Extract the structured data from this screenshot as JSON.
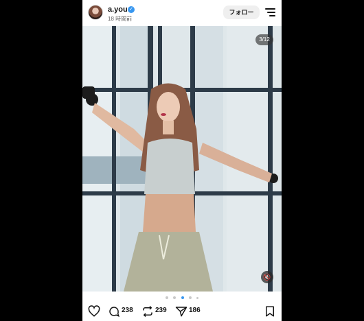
{
  "header": {
    "username": "a.you",
    "timestamp": "18 時間前",
    "follow_label": "フォロー",
    "verified_icon": "verified-badge-icon",
    "menu_icon": "hamburger-menu-icon"
  },
  "media": {
    "counter": "3/12",
    "mute_icon": "speaker-muted-icon"
  },
  "carousel": {
    "dot_count": 5,
    "active_index": 2
  },
  "actions": {
    "like_icon": "heart-icon",
    "comments": "238",
    "reposts": "239",
    "shares": "186",
    "save_icon": "bookmark-icon"
  },
  "colors": {
    "verified": "#3897f0",
    "active_dot": "#3897f0"
  }
}
